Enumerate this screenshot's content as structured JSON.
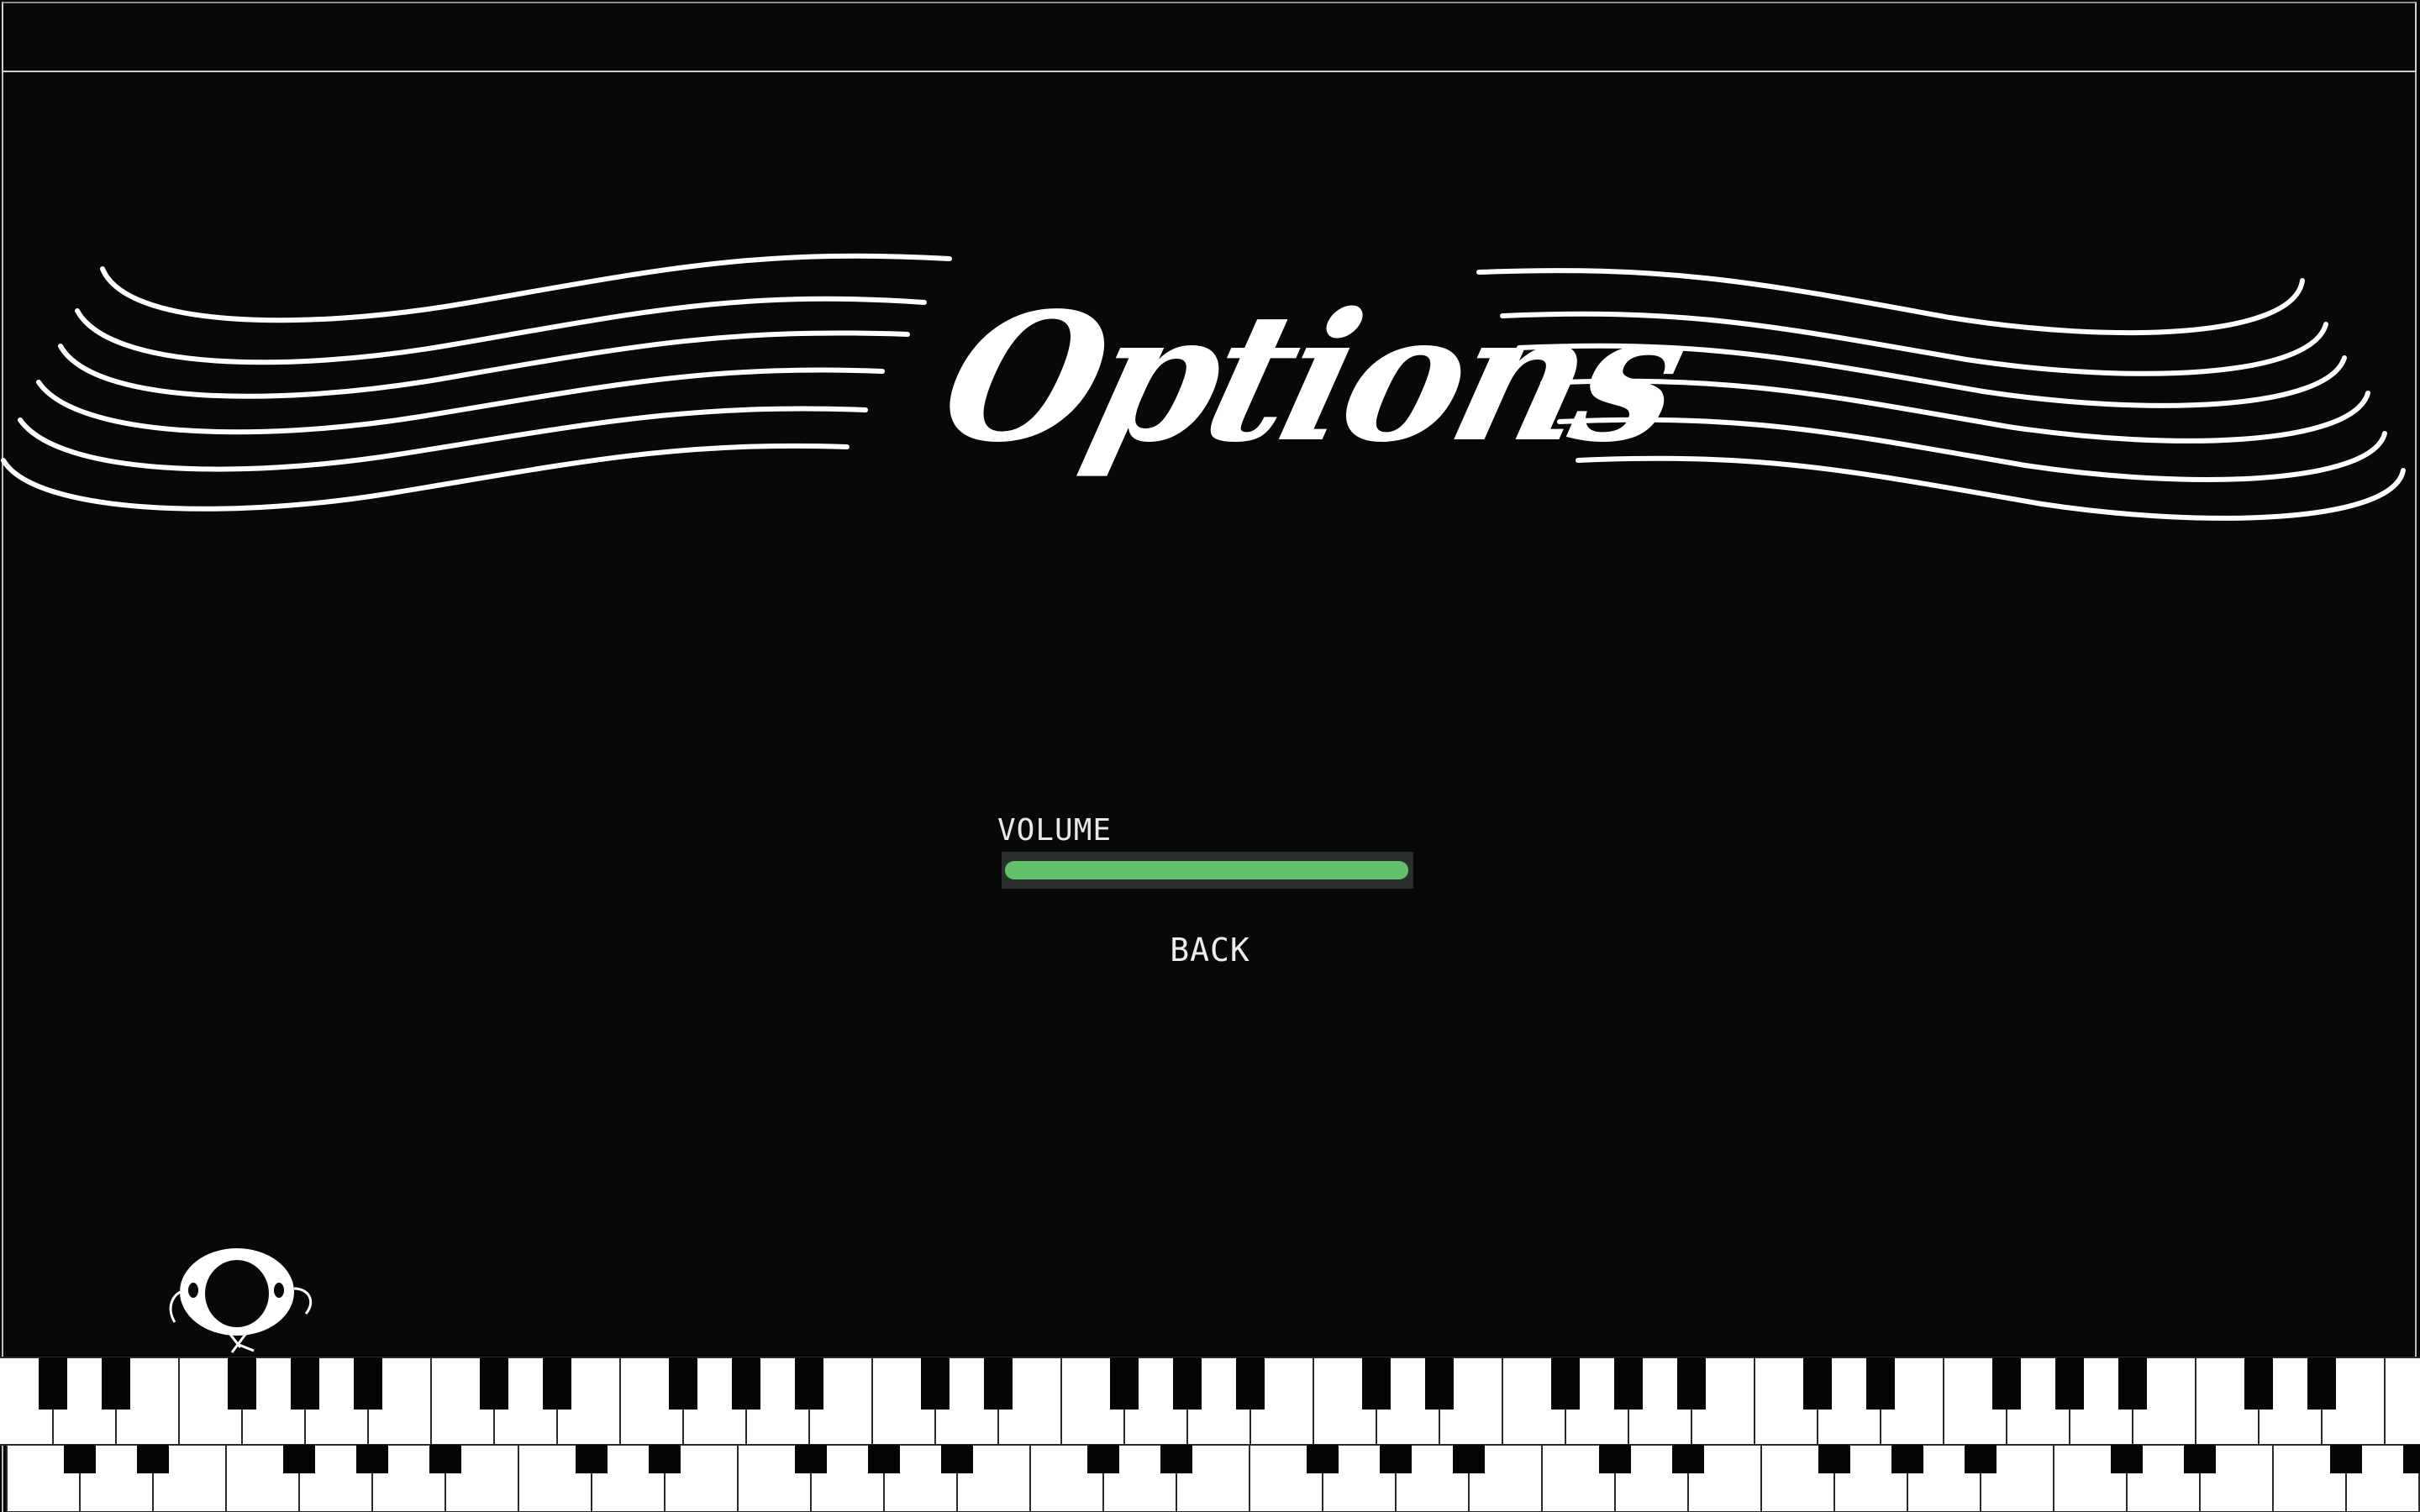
{
  "screen": {
    "title": "Options"
  },
  "settings": {
    "volume": {
      "label": "VOLUME",
      "level": 1.0
    },
    "back_label": "BACK"
  },
  "colors": {
    "background": "#070908",
    "foreground": "#ffffff",
    "slider_fill": "#62c06c",
    "slider_track": "#5d7f8a"
  },
  "decor": {
    "mascot_icon": "eyeball-creature-icon",
    "keyboard_icon": "piano-keyboard-icon"
  }
}
